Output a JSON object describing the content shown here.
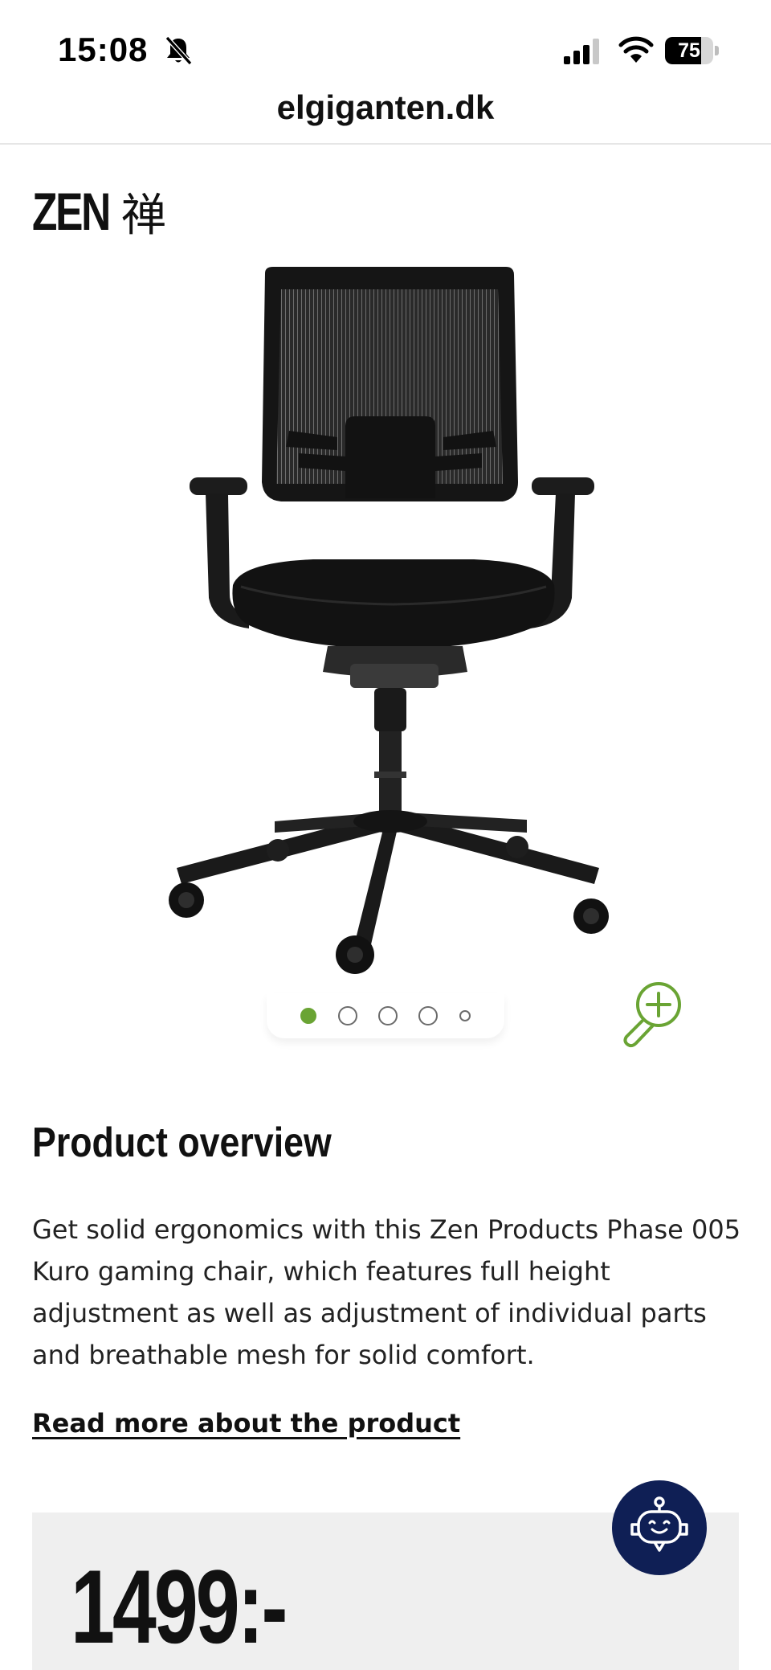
{
  "status_bar": {
    "time": "15:08",
    "battery_level": 75,
    "battery_label": "75",
    "icons": [
      "bell-slash-icon",
      "signal-icon",
      "wifi-icon",
      "battery-icon"
    ]
  },
  "browser": {
    "url": "elgiganten.dk"
  },
  "brand": {
    "name": "ZEN",
    "kanji": "禅"
  },
  "gallery": {
    "image_alt": "product-photo-office-chair",
    "dots": [
      {
        "state": "active"
      },
      {
        "state": "normal"
      },
      {
        "state": "normal"
      },
      {
        "state": "normal"
      },
      {
        "state": "small"
      }
    ],
    "zoom_icon": "zoom-in-icon"
  },
  "overview": {
    "heading": "Product overview",
    "description": "Get solid ergonomics with this Zen Products Phase 005 Kuro gaming chair, which features full height adjustment as well as adjustment of individual parts and breathable mesh for solid comfort.",
    "read_more_label": "Read more about the product"
  },
  "price": {
    "amount": "1499:-"
  },
  "chat": {
    "icon": "chat-robot-icon"
  },
  "colors": {
    "accent_green": "#6aa434",
    "chat_navy": "#0f1f55",
    "price_panel_bg": "#efefef"
  }
}
